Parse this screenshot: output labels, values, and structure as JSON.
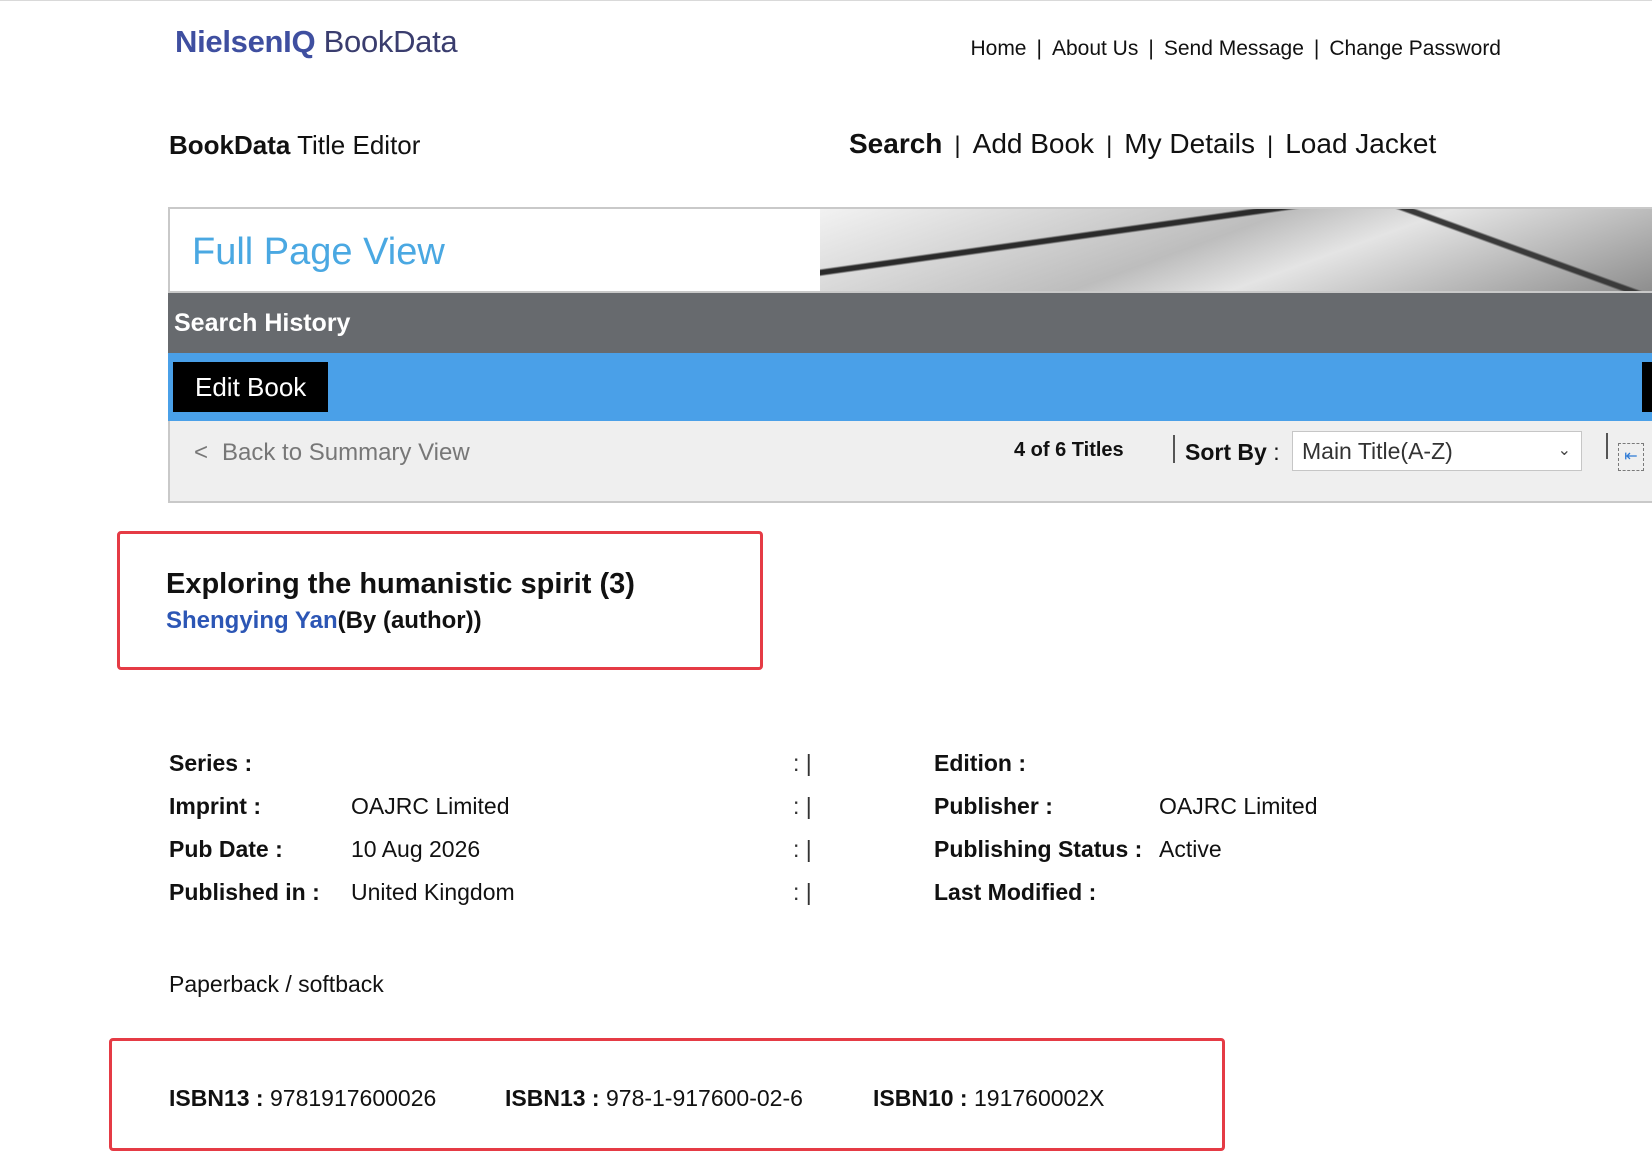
{
  "brand": {
    "logo_prefix": "NielsenIQ",
    "logo_product": "BookData"
  },
  "top_nav": [
    "Home",
    "About Us",
    "Send Message",
    "Change Password"
  ],
  "app_title": {
    "bold": "BookData",
    "rest": " Title Editor"
  },
  "main_nav": [
    "Search",
    "Add Book",
    "My Details",
    "Load Jacket"
  ],
  "page_title": "Full Page View",
  "search_history": "Search History",
  "edit_book": "Edit Book",
  "summary": {
    "back_chevron": "<",
    "back_label": "Back to Summary View",
    "count": "4 of 6 Titles",
    "sort_label": "Sort By",
    "sort_colon": ":",
    "sort_value": "Main Title(A-Z)"
  },
  "book": {
    "title": "Exploring the humanistic spirit (3)",
    "author": "Shengying Yan",
    "author_role": "(By (author))"
  },
  "details": {
    "left": [
      {
        "label": "Series :",
        "value": ""
      },
      {
        "label": "Imprint :",
        "value": "OAJRC Limited"
      },
      {
        "label": "Pub Date :",
        "value": "10 Aug 2026"
      },
      {
        "label": "Published in :",
        "value": "United Kingdom"
      }
    ],
    "separator": ": |",
    "right": [
      {
        "label": "Edition :",
        "value": ""
      },
      {
        "label": "Publisher :",
        "value": "OAJRC Limited"
      },
      {
        "label": "Publishing Status :",
        "value": "Active"
      },
      {
        "label": "Last Modified :",
        "value": ""
      }
    ]
  },
  "format": "Paperback / softback",
  "isbn": [
    {
      "label": "ISBN13 :",
      "value": "9781917600026"
    },
    {
      "label": "ISBN13 :",
      "value": "978-1-917600-02-6"
    },
    {
      "label": "ISBN10 :",
      "value": "191760002X"
    }
  ],
  "colors": {
    "accent_blue": "#4aa0e8",
    "title_blue": "#4aa8e2",
    "highlight_red": "#e53b45",
    "author_blue": "#2c56b5"
  }
}
